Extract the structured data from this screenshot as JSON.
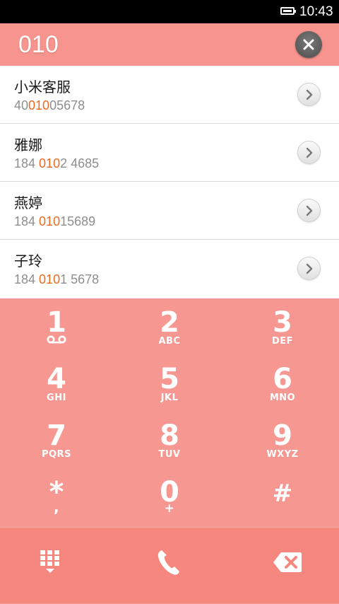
{
  "status_bar": {
    "time": "10:43",
    "battery_icon": "battery-icon"
  },
  "header": {
    "dialed_number": "010",
    "clear_icon": "close-icon"
  },
  "results": [
    {
      "name": "小米客服",
      "number_before": "40",
      "number_match": "010",
      "number_after": "05678"
    },
    {
      "name": "雅娜",
      "number_before": "184 ",
      "number_match": "010",
      "number_after": "2 4685"
    },
    {
      "name": "燕婷",
      "number_before": "184 ",
      "number_match": "010",
      "number_after": "15689"
    },
    {
      "name": "子玲",
      "number_before": "184 ",
      "number_match": "010",
      "number_after": "1 5678"
    }
  ],
  "keypad": [
    {
      "digit": "1",
      "letters": "",
      "icon": "voicemail-icon"
    },
    {
      "digit": "2",
      "letters": "ABC"
    },
    {
      "digit": "3",
      "letters": "DEF"
    },
    {
      "digit": "4",
      "letters": "GHI"
    },
    {
      "digit": "5",
      "letters": "JKL"
    },
    {
      "digit": "6",
      "letters": "MNO"
    },
    {
      "digit": "7",
      "letters": "PQRS"
    },
    {
      "digit": "8",
      "letters": "TUV"
    },
    {
      "digit": "9",
      "letters": "WXYZ"
    },
    {
      "digit": "*",
      "letters": ","
    },
    {
      "digit": "0",
      "letters": "+"
    },
    {
      "digit": "#",
      "letters": ""
    }
  ],
  "actions": [
    "dialpad-toggle-icon",
    "phone-call-icon",
    "backspace-icon"
  ],
  "colors": {
    "header_bg": "#f6948d",
    "dialpad_bg": "#f69891",
    "action_bar_bg": "#f5877f",
    "match_highlight": "#ef6a1f"
  }
}
